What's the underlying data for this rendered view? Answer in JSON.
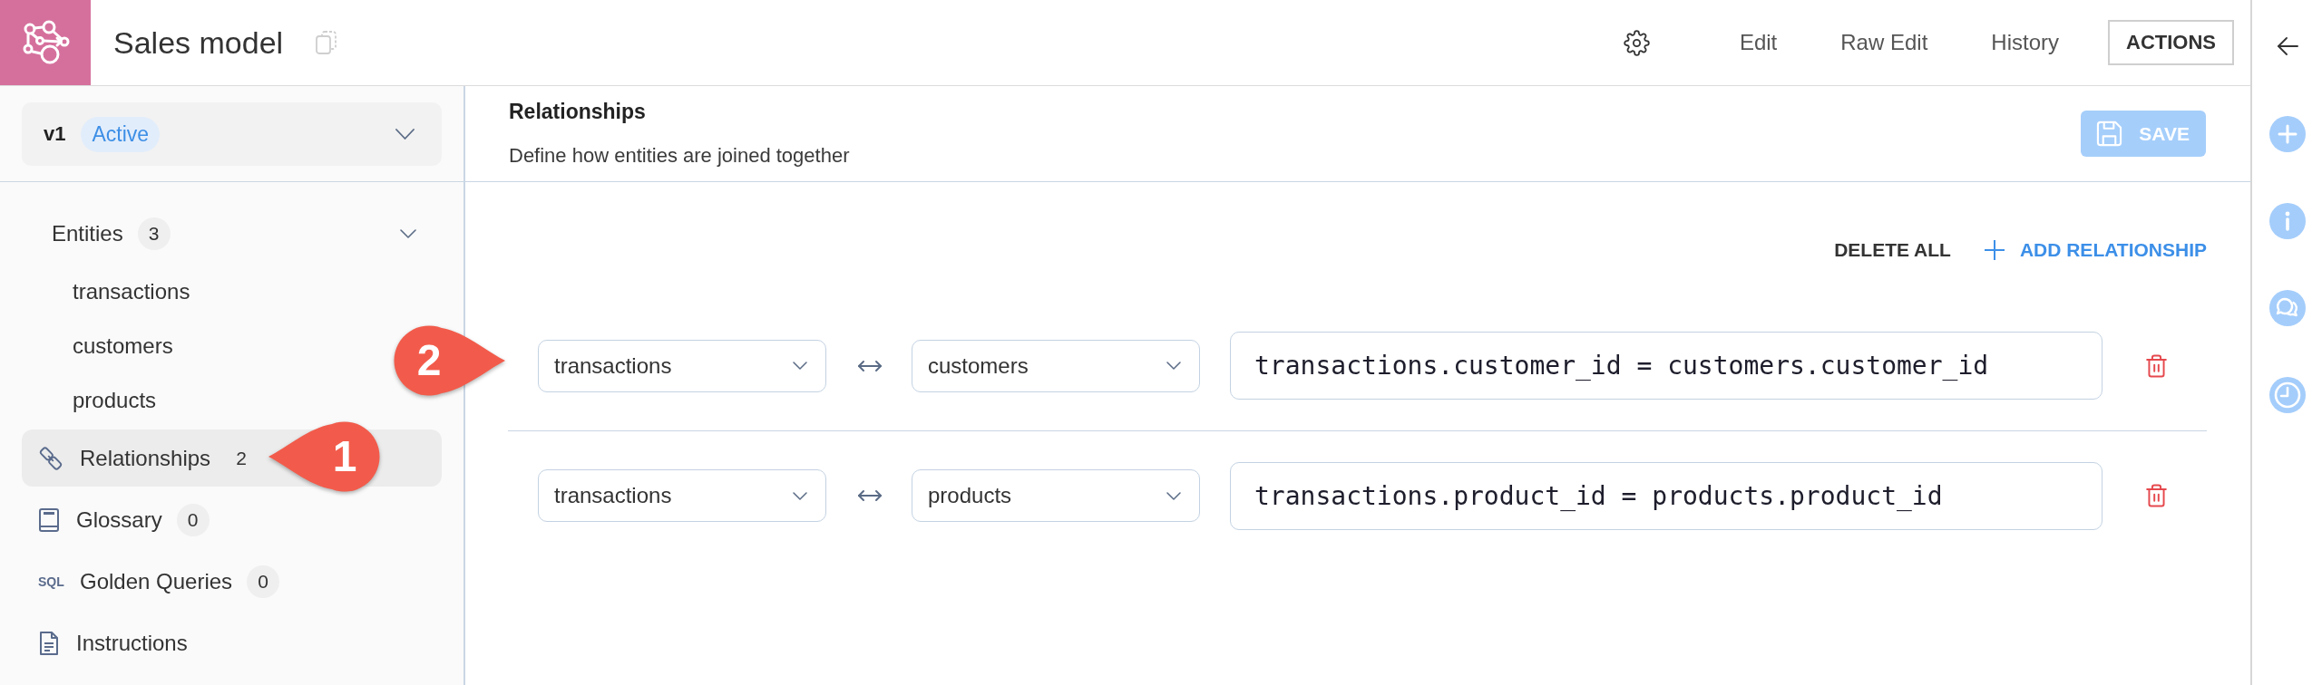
{
  "header": {
    "title": "Sales model",
    "nav": [
      {
        "label": "Edit"
      },
      {
        "label": "Raw Edit"
      },
      {
        "label": "History"
      }
    ],
    "actions_button": "ACTIONS"
  },
  "sidebar": {
    "version": {
      "label": "v1",
      "status": "Active"
    },
    "items": [
      {
        "kind": "group",
        "label": "Entities",
        "count": "3",
        "expanded": true,
        "children": [
          {
            "label": "transactions",
            "selected": false
          },
          {
            "label": "customers",
            "selected": false
          },
          {
            "label": "products",
            "selected": false
          }
        ]
      },
      {
        "kind": "relationships",
        "label": "Relationships",
        "count": "2",
        "selected": true,
        "callout": "1"
      },
      {
        "kind": "glossary",
        "label": "Glossary",
        "count": "0",
        "selected": false
      },
      {
        "kind": "queries",
        "icon_text": "SQL",
        "label": "Golden Queries",
        "count": "0",
        "selected": false
      },
      {
        "kind": "instructions",
        "label": "Instructions",
        "selected": false
      }
    ]
  },
  "panel": {
    "title": "Relationships",
    "description": "Define how entities are joined together",
    "save_button": {
      "label": "SAVE",
      "disabled": true
    }
  },
  "toolbar": {
    "delete_all": "DELETE ALL",
    "add": "ADD RELATIONSHIP"
  },
  "relationships": [
    {
      "left": "transactions",
      "right": "customers",
      "expression": "transactions.customer_id = customers.customer_id",
      "callout": "2"
    },
    {
      "left": "transactions",
      "right": "products",
      "expression": "transactions.product_id = products.product_id"
    }
  ]
}
